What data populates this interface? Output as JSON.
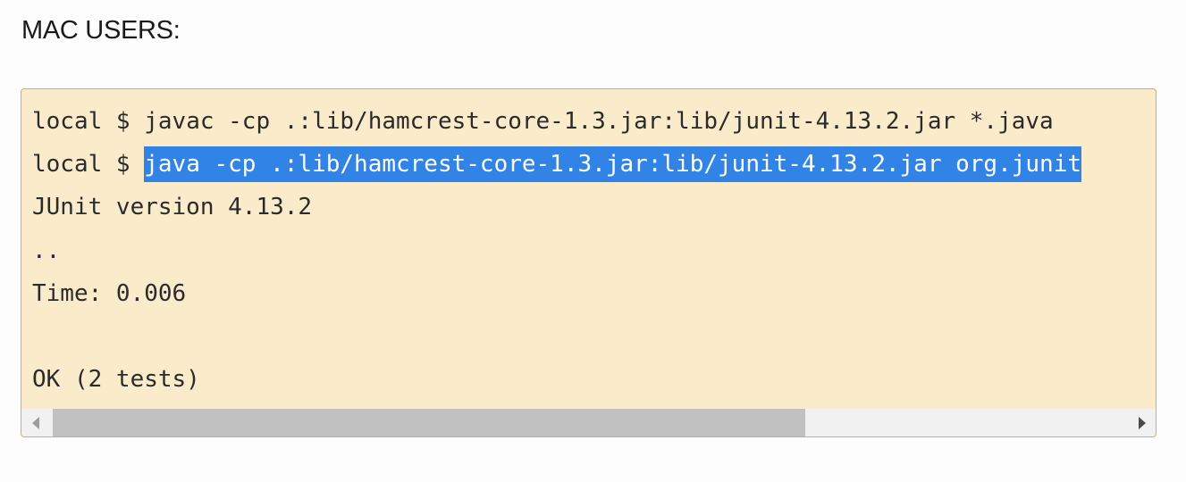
{
  "heading": "MAC USERS:",
  "code": {
    "lines": [
      {
        "prefix": "local $ ",
        "text": "javac -cp .:lib/hamcrest-core-1.3.jar:lib/junit-4.13.2.jar *.java",
        "selected": false
      },
      {
        "prefix": "local $ ",
        "text": "java -cp .:lib/hamcrest-core-1.3.jar:lib/junit-4.13.2.jar org.junit",
        "selected": true
      },
      {
        "prefix": "",
        "text": "JUnit version 4.13.2",
        "selected": false
      },
      {
        "prefix": "",
        "text": "..",
        "selected": false
      },
      {
        "prefix": "",
        "text": "Time: 0.006",
        "selected": false
      },
      {
        "prefix": "",
        "text": "",
        "selected": false
      },
      {
        "prefix": "",
        "text": "OK (2 tests)",
        "selected": false
      }
    ]
  },
  "scrollbar": {
    "left_icon": "scroll-left-arrow-icon",
    "right_icon": "scroll-right-arrow-icon",
    "thumb_fraction": 0.7,
    "position_fraction": 0.0
  },
  "colors": {
    "code_background": "#faebca",
    "code_border": "#e3b21f",
    "selection": "#3184e6"
  }
}
